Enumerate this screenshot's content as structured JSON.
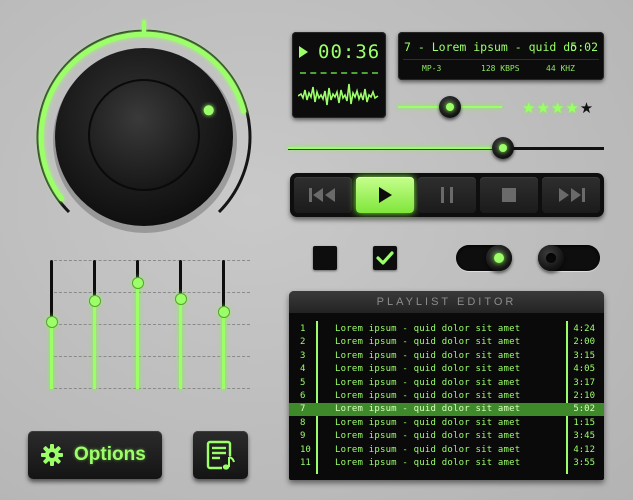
{
  "colors": {
    "accent": "#9cff6a",
    "accent_glow": "#7cff3a",
    "panel": "#0e0e0e",
    "background": "#c2c2c2",
    "selected_row": "#3e8a2a"
  },
  "volume_knob": {
    "level": 0.78
  },
  "lcd_time": {
    "time": "00:36",
    "play_icon": "play-icon"
  },
  "lcd_track": {
    "title": "7 - Lorem ipsum - quid do",
    "duration": "5:02",
    "format": "MP-3",
    "bitrate": "128 KBPS",
    "samplerate": "44 KHZ"
  },
  "balance_slider": {
    "value": 0.5
  },
  "rating": {
    "stars_on": "★★★★",
    "stars_off": "★",
    "value": 4,
    "max": 5
  },
  "seek_slider": {
    "value": 0.68
  },
  "transport": {
    "buttons": [
      {
        "name": "previous",
        "icon": "skip-back-icon"
      },
      {
        "name": "play",
        "icon": "play-icon",
        "active": true
      },
      {
        "name": "pause",
        "icon": "pause-icon"
      },
      {
        "name": "stop",
        "icon": "stop-icon"
      },
      {
        "name": "next",
        "icon": "skip-forward-icon"
      }
    ]
  },
  "checkboxes": [
    {
      "checked": false
    },
    {
      "checked": true
    }
  ],
  "toggles": [
    {
      "on": true
    },
    {
      "on": false
    }
  ],
  "equalizer": {
    "bands": [
      0.52,
      0.68,
      0.82,
      0.7,
      0.6
    ]
  },
  "options_button": {
    "label": "Options",
    "icon": "gear-icon"
  },
  "playlist_button": {
    "icon": "playlist-music-icon"
  },
  "playlist": {
    "header": "PLAYLIST EDITOR",
    "selected_index": 6,
    "items": [
      {
        "num": "1",
        "title": "Lorem ipsum - quid dolor sit amet",
        "duration": "4:24"
      },
      {
        "num": "2",
        "title": "Lorem ipsum - quid dolor sit amet",
        "duration": "2:00"
      },
      {
        "num": "3",
        "title": "Lorem ipsum - quid dolor sit amet",
        "duration": "3:15"
      },
      {
        "num": "4",
        "title": "Lorem ipsum - quid dolor sit amet",
        "duration": "4:05"
      },
      {
        "num": "5",
        "title": "Lorem ipsum - quid dolor sit amet",
        "duration": "3:17"
      },
      {
        "num": "6",
        "title": "Lorem ipsum - quid dolor sit amet",
        "duration": "2:10"
      },
      {
        "num": "7",
        "title": "Lorem ipsum - quid dolor sit amet",
        "duration": "5:02"
      },
      {
        "num": "8",
        "title": "Lorem ipsum - quid dolor sit amet",
        "duration": "1:15"
      },
      {
        "num": "9",
        "title": "Lorem ipsum - quid dolor sit amet",
        "duration": "3:45"
      },
      {
        "num": "10",
        "title": "Lorem ipsum - quid dolor sit amet",
        "duration": "4:12"
      },
      {
        "num": "11",
        "title": "Lorem ipsum - quid dolor sit amet",
        "duration": "3:55"
      }
    ]
  }
}
